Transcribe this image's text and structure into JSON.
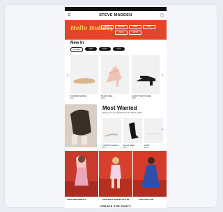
{
  "header": {
    "logo": "STEVE MADDEN",
    "icons": [
      "menu-icon",
      "search-icon",
      "account-icon",
      "bag-icon"
    ]
  },
  "promo": {
    "script_text": "Hello Holiday",
    "ctas": [
      "SHOP",
      "WOMEN",
      "MEN",
      "KIDS",
      "SALE",
      "GIFTS"
    ],
    "background": "#e4452a",
    "accent": "#f7d057"
  },
  "new_in": {
    "title": "New In",
    "chips": [
      "WOMEN",
      "MEN",
      "BAGS",
      "KIDS"
    ],
    "products": [
      {
        "name": "CAYENNE SANDAL",
        "price": "$99"
      },
      {
        "name": "SILVER HEEL",
        "price": "$110"
      },
      {
        "name": "CHUNKY BLOCK HEEL",
        "price": "$120"
      }
    ]
  },
  "most_wanted": {
    "title": "Most Wanted",
    "subtitle": "Shop your new favorites in the latest styles",
    "products": [
      {
        "name": "STRAPPY SANDAL",
        "price": "$89"
      },
      {
        "name": "BLACK HEEL",
        "price": "$99"
      },
      {
        "name": "PUMP",
        "price": "$109"
      }
    ]
  },
  "editorial": {
    "tags": [
      "SHOP NEW ARRIVALS",
      "SHOP MOST WANTED STYLES",
      "SHOP THE LOOK"
    ]
  },
  "bottom_banner": {
    "title": "CREATE THE PARTY"
  }
}
